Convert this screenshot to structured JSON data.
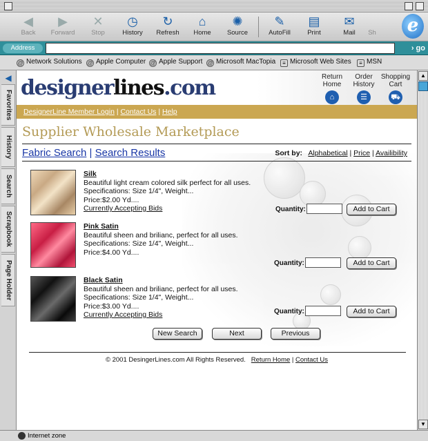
{
  "toolbar": {
    "buttons": [
      {
        "label": "Back"
      },
      {
        "label": "Forward"
      },
      {
        "label": "Stop"
      },
      {
        "label": "History"
      },
      {
        "label": "Refresh"
      },
      {
        "label": "Home"
      },
      {
        "label": "Source"
      },
      {
        "label": "AutoFill"
      },
      {
        "label": "Print"
      },
      {
        "label": "Mail"
      },
      {
        "label": "Sh"
      }
    ]
  },
  "address": {
    "label": "Address",
    "go": "go",
    "value": ""
  },
  "favorites": [
    "Network Solutions",
    "Apple Computer",
    "Apple Support",
    "Microsoft MacTopia",
    "Microsoft Web Sites",
    "MSN"
  ],
  "sidebar_tabs": [
    "Favorites",
    "History",
    "Search",
    "Scrapbook",
    "Page Holder"
  ],
  "site": {
    "logo_main": "designer",
    "logo_bold": "lines",
    "logo_tld": ".com",
    "nav": [
      {
        "label_1": "Return",
        "label_2": "Home"
      },
      {
        "label_1": "Order",
        "label_2": "History"
      },
      {
        "label_1": "Shopping",
        "label_2": "Cart"
      }
    ],
    "gold_links": [
      "DesignerLine Member Login",
      "Contact Us",
      "Help"
    ],
    "page_title": "Supplier Wholesale Marketplace",
    "crumbs": [
      "Fabric Search",
      "Search Results"
    ],
    "sort_label": "Sort by:",
    "sort_options": [
      "Alphabetical",
      "Price",
      "Availibility"
    ]
  },
  "products": [
    {
      "name": "Silk",
      "desc": "Beautiful light cream colored silk perfect for all uses.",
      "spec": "Specifications: Size 1/4\", Weight...",
      "price": "Price:$2.00 Yd....",
      "bids": "Currently Accepting Bids"
    },
    {
      "name": "Pink Satin",
      "desc": "Beautiful sheen and brilianc, perfect for all uses.",
      "spec": "Specifications: Size 1/4\", Weight...",
      "price": "Price:$4.00 Yd....",
      "bids": ""
    },
    {
      "name": "Black Satin",
      "desc": "Beautiful sheen and brilianc, perfect for all uses.",
      "spec": "Specifications: Size 1/4\", Weight...",
      "price": "Price:$3.00 Yd....",
      "bids": "Currently Accepting Bids"
    }
  ],
  "quantity_label": "Quantity:",
  "add_to_cart": "Add to Cart",
  "pager": {
    "new_search": "New Search",
    "next": "Next",
    "previous": "Previous"
  },
  "footer": {
    "copyright": "© 2001 DesingerLines.com All Rights Reserved.",
    "return_home": "Return Home",
    "contact": "Contact Us"
  },
  "status": "Internet zone"
}
